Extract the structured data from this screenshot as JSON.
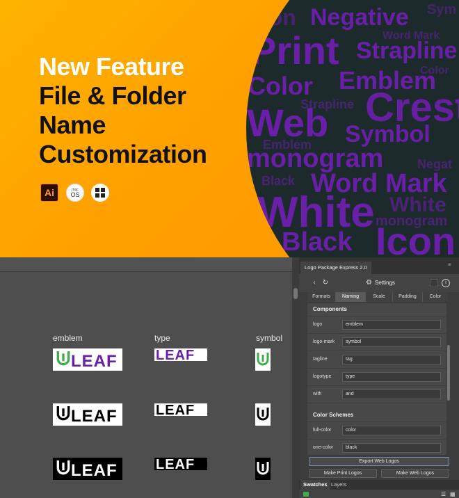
{
  "banner": {
    "headline": [
      "New Feature",
      "File & Folder",
      "Name",
      "Customization"
    ],
    "app_icons": [
      {
        "name": "illustrator-icon",
        "text": "Ai"
      },
      {
        "name": "macos-icon",
        "text_top": "mac",
        "text_bottom": "OS"
      },
      {
        "name": "windows-icon"
      }
    ],
    "word_cloud": [
      {
        "text": "Icon"
      },
      {
        "text": "Negative"
      },
      {
        "text": "Sym"
      },
      {
        "text": "Print"
      },
      {
        "text": "Word Mark"
      },
      {
        "text": "Strapline"
      },
      {
        "text": "Color"
      },
      {
        "text": "Color"
      },
      {
        "text": "Emblem"
      },
      {
        "text": "Strapline"
      },
      {
        "text": "Crest"
      },
      {
        "text": "Web"
      },
      {
        "text": "Symbol"
      },
      {
        "text": "Emblem"
      },
      {
        "text": "monogram"
      },
      {
        "text": "Negat"
      },
      {
        "text": "Black"
      },
      {
        "text": "Word Mark"
      },
      {
        "text": "White"
      },
      {
        "text": "White"
      },
      {
        "text": "monogram"
      },
      {
        "text": "Black"
      },
      {
        "text": "Icon"
      }
    ],
    "colors": {
      "orange": "#ffa000",
      "dark": "#1c2a2c",
      "purple": "#6a1fa8"
    }
  },
  "canvas": {
    "columns": [
      "emblem",
      "type",
      "symbol"
    ],
    "logo_text": "LEAF"
  },
  "panel": {
    "title": "Logo Package Express 2.0",
    "toolbar": {
      "back": "‹",
      "refresh": "↻",
      "settings": "Settings",
      "info": "i"
    },
    "tabs": [
      "Formats",
      "Naming",
      "Scale",
      "Padding",
      "Color"
    ],
    "active_tab": "Naming",
    "components_title": "Components",
    "components": [
      {
        "label": "logo",
        "value": "emblem"
      },
      {
        "label": "logo-mark",
        "value": "symbol"
      },
      {
        "label": "tagline",
        "value": "tag"
      },
      {
        "label": "logotype",
        "value": "type"
      },
      {
        "label": "with",
        "value": "and"
      }
    ],
    "color_schemes_title": "Color Schemes",
    "color_schemes": [
      {
        "label": "full-color",
        "value": "color"
      },
      {
        "label": "one-color",
        "value": "black"
      }
    ],
    "buttons": {
      "export_web": "Export Web Logos",
      "make_print": "Make Print Logos",
      "make_web": "Make Web Logos"
    },
    "bottom_tabs": [
      "Swatches",
      "Layers"
    ]
  }
}
